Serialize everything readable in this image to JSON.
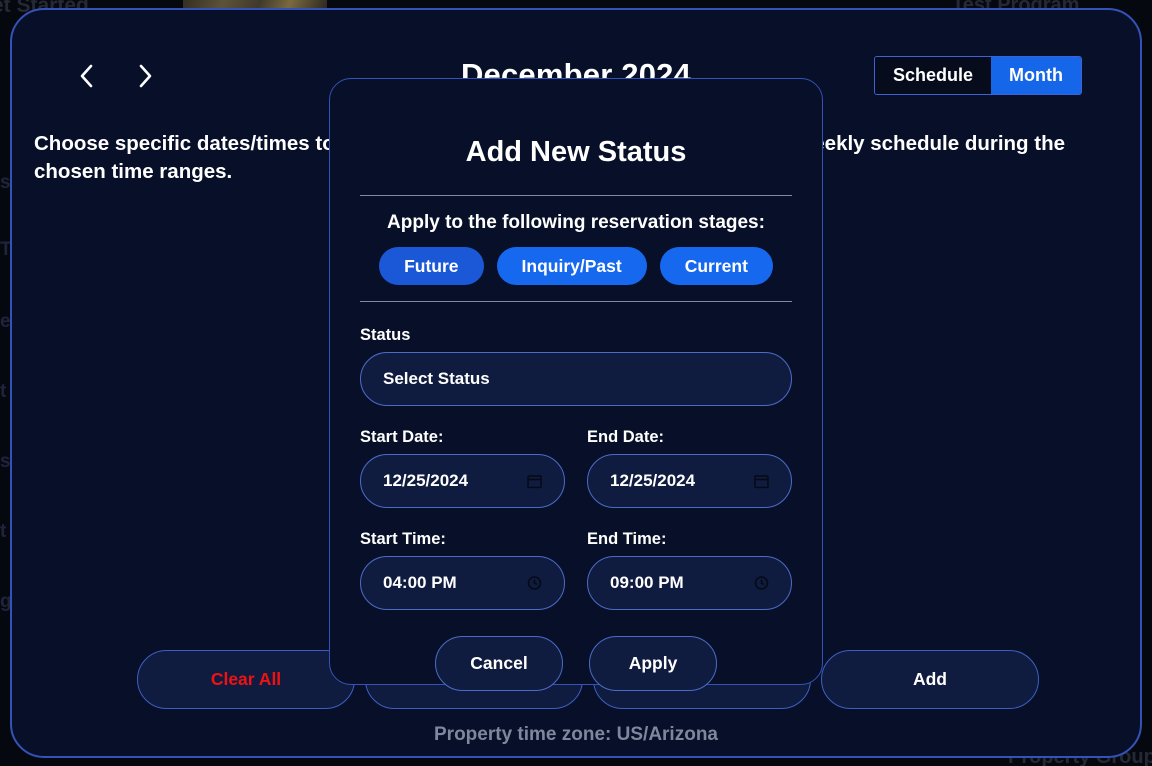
{
  "background": {
    "top_left_text": "et Started",
    "top_right_text": "Test Program",
    "bottom_right_text": "Property Group",
    "sidebar_letters": [
      "s",
      "T",
      "e",
      "t",
      "si",
      "t",
      "g"
    ]
  },
  "header": {
    "prev_label": "‹",
    "next_label": "›",
    "month_title": "December 2024",
    "view_toggle": {
      "schedule_label": "Schedule",
      "month_label": "Month",
      "selected": "Month"
    }
  },
  "page": {
    "subtitle": "Choose specific dates/times to set a status. These selections will override the weekly schedule during the chosen time ranges.",
    "timezone_note": "Property time zone: US/Arizona"
  },
  "bottom_actions": {
    "buttons": [
      {
        "label": "Clear All",
        "style": "danger"
      },
      {
        "label": "",
        "style": "normal"
      },
      {
        "label": "",
        "style": "normal"
      },
      {
        "label": "Add",
        "style": "normal"
      }
    ]
  },
  "modal": {
    "title": "Add New Status",
    "stages_label": "Apply to the following reservation stages:",
    "stages": [
      {
        "label": "Future",
        "selected": true
      },
      {
        "label": "Inquiry/Past",
        "selected": false
      },
      {
        "label": "Current",
        "selected": false
      }
    ],
    "status": {
      "label": "Status",
      "value": "Select Status",
      "placeholder": "Select Status"
    },
    "start_date": {
      "label": "Start Date:",
      "value": "12/25/2024",
      "icon": "calendar-icon"
    },
    "end_date": {
      "label": "End Date:",
      "value": "12/25/2024",
      "icon": "calendar-icon"
    },
    "start_time": {
      "label": "Start Time:",
      "value": "04:00 PM",
      "icon": "clock-icon"
    },
    "end_time": {
      "label": "End Time:",
      "value": "09:00 PM",
      "icon": "clock-icon"
    },
    "cancel_label": "Cancel",
    "apply_label": "Apply"
  },
  "colors": {
    "accent_blue": "#1566e8",
    "pill_blue": "#1668ef",
    "card_bg": "#081029",
    "card_border": "#3452b8",
    "danger_red": "#f01212",
    "muted_text": "#7e879c"
  }
}
